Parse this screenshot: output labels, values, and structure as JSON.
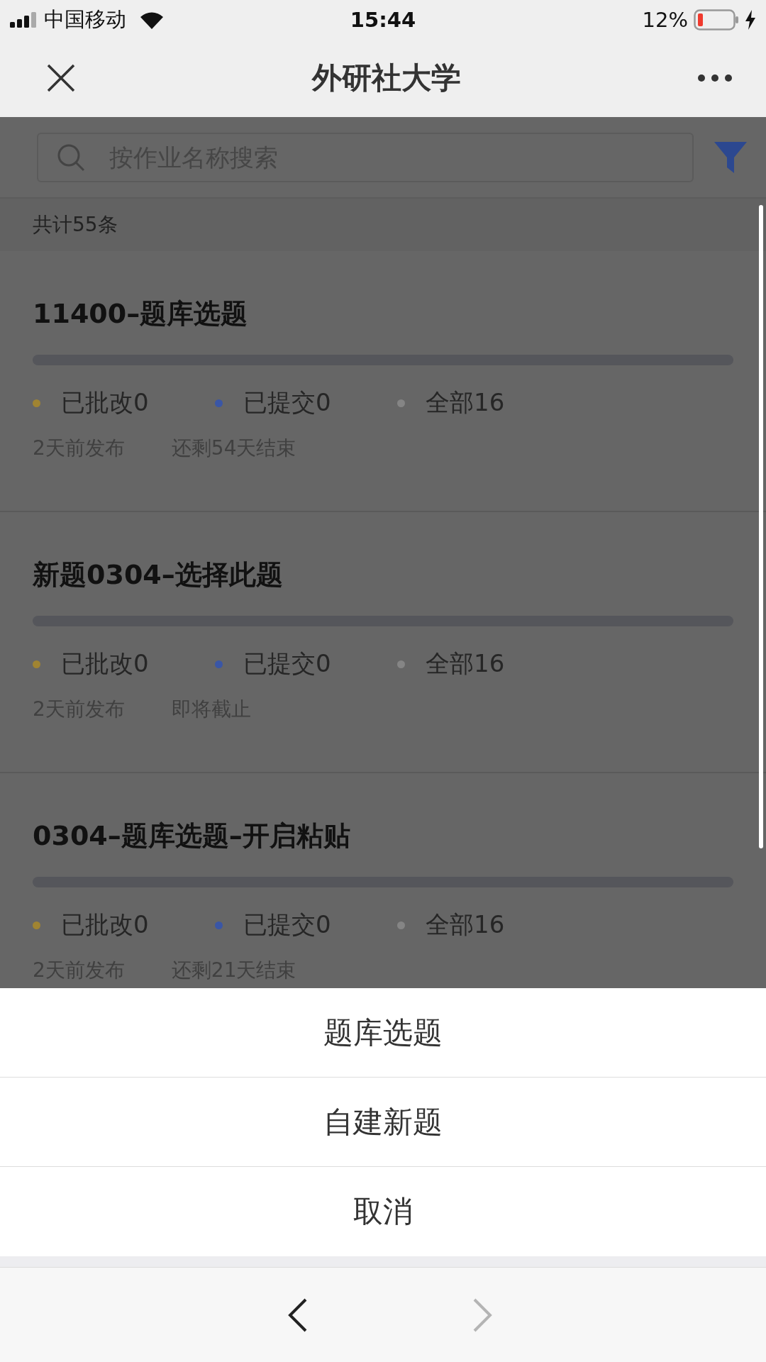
{
  "status_bar": {
    "carrier": "中国移动",
    "time": "15:44",
    "battery": "12%"
  },
  "nav": {
    "title": "外研社大学"
  },
  "search": {
    "placeholder": "按作业名称搜索"
  },
  "count": "共计55条",
  "cards": [
    {
      "title": "11400–题库选题",
      "stats": [
        {
          "label": "已批改0",
          "color": "#a08432"
        },
        {
          "label": "已提交0",
          "color": "#3a56a6"
        },
        {
          "label": "全部16",
          "color": "#858585"
        }
      ],
      "published": "2天前发布",
      "deadline": "还剩54天结束"
    },
    {
      "title": "新题0304–选择此题",
      "stats": [
        {
          "label": "已批改0",
          "color": "#a08432"
        },
        {
          "label": "已提交0",
          "color": "#3a56a6"
        },
        {
          "label": "全部16",
          "color": "#858585"
        }
      ],
      "published": "2天前发布",
      "deadline": "即将截止"
    },
    {
      "title": "0304–题库选题–开启粘贴",
      "stats": [
        {
          "label": "已批改0",
          "color": "#a08432"
        },
        {
          "label": "已提交0",
          "color": "#3a56a6"
        },
        {
          "label": "全部16",
          "color": "#858585"
        }
      ],
      "published": "2天前发布",
      "deadline": "还剩21天结束"
    }
  ],
  "action_sheet": [
    "题库选题",
    "自建新题",
    "取消"
  ],
  "toolbar": [
    {
      "kind": "back",
      "disabled": false
    },
    {
      "kind": "forward",
      "disabled": true
    }
  ]
}
